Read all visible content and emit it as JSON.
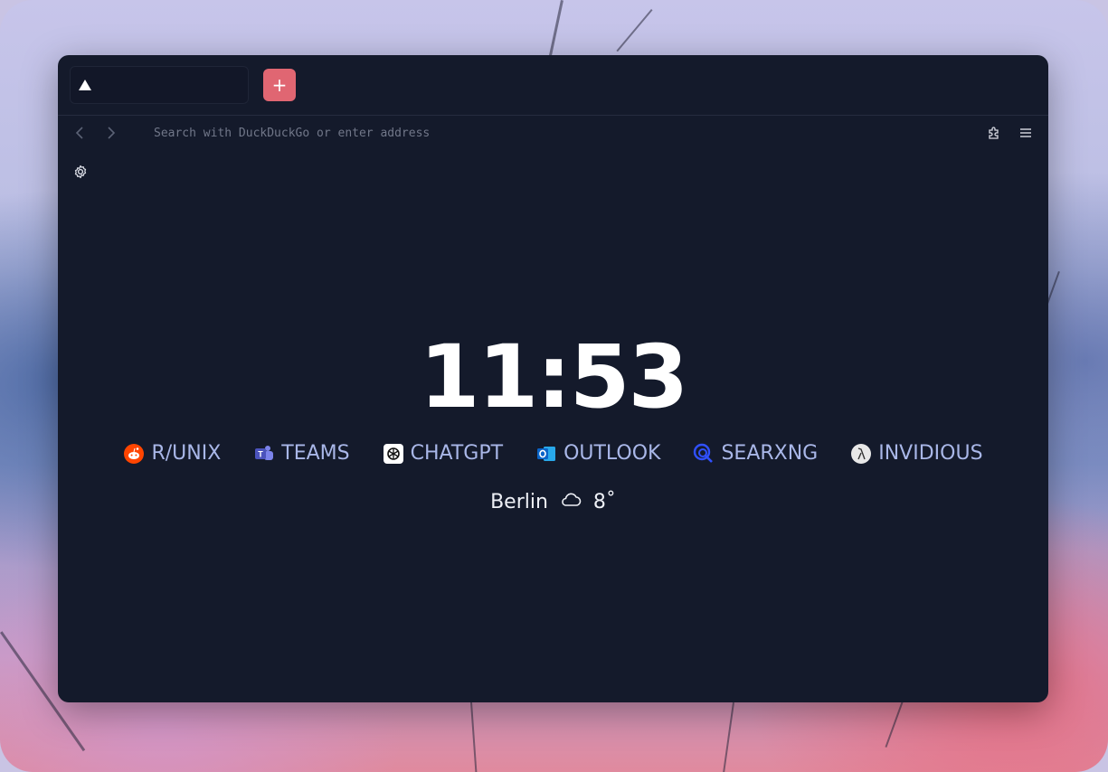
{
  "browser": {
    "new_tab_symbol": "+",
    "address_placeholder": "Search with DuckDuckGo or enter address"
  },
  "newtab_page": {
    "time": "11:53",
    "links": [
      {
        "label": "R/UNIX",
        "icon": "reddit-icon",
        "color": "#ff4500"
      },
      {
        "label": "TEAMS",
        "icon": "teams-icon",
        "color": "#6264a7"
      },
      {
        "label": "CHATGPT",
        "icon": "chatgpt-icon",
        "color": "#ffffff"
      },
      {
        "label": "OUTLOOK",
        "icon": "outlook-icon",
        "color": "#0a64c8"
      },
      {
        "label": "SEARXNG",
        "icon": "searxng-icon",
        "color": "#3050ff"
      },
      {
        "label": "INVIDIOUS",
        "icon": "invidious-icon",
        "color": "#e8e8e8"
      }
    ],
    "weather": {
      "city": "Berlin",
      "icon": "cloud-icon",
      "temperature": "8˚"
    }
  },
  "colors": {
    "window_bg": "#141a2b",
    "accent": "#e06672",
    "link_text": "#a9b7e8"
  }
}
